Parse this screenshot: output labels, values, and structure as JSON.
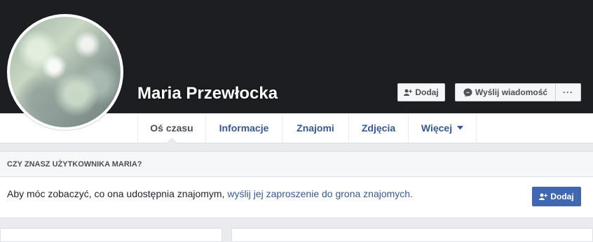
{
  "profile": {
    "name": "Maria Przewłocka"
  },
  "cover_actions": {
    "add_friend_label": "Dodaj",
    "message_label": "Wyślij wiadomość",
    "more_label": "···"
  },
  "nav": {
    "tabs": [
      {
        "label": "Oś czasu"
      },
      {
        "label": "Informacje"
      },
      {
        "label": "Znajomi"
      },
      {
        "label": "Zdjęcia"
      },
      {
        "label": "Więcej"
      }
    ]
  },
  "friend_panel": {
    "heading": "CZY ZNASZ UŻYTKOWNIKA MARIA?",
    "text": "Aby móc zobaczyć, co ona udostępnia znajomym, ",
    "link": "wyślij jej zaproszenie do grona znajomych.",
    "add_label": "Dodaj"
  },
  "colors": {
    "cover": "#1d1e22",
    "link": "#365899",
    "primary_button": "#4267b2"
  }
}
